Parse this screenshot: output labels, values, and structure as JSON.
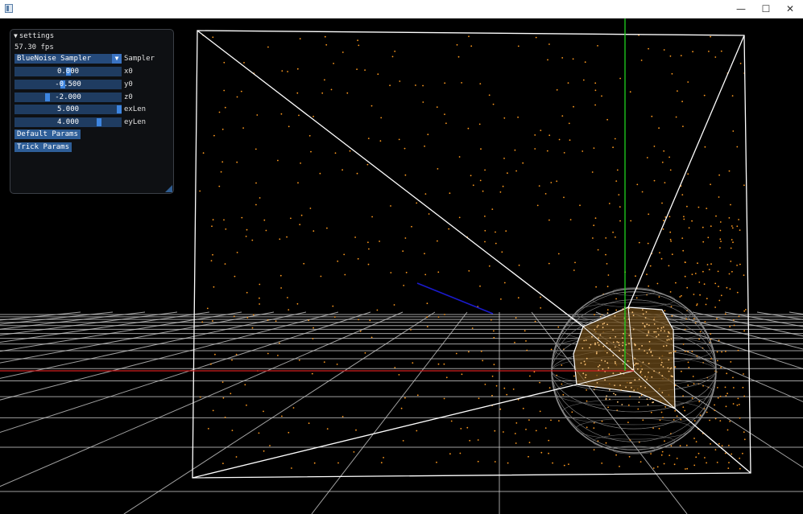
{
  "window": {
    "title": "",
    "minimize_glyph": "—",
    "maximize_glyph": "☐",
    "close_glyph": "✕"
  },
  "panel": {
    "title": "settings",
    "fps": "57.30 fps",
    "sampler": {
      "value": "BlueNoise Sampler",
      "label": "Sampler"
    },
    "params": [
      {
        "label": "x0",
        "value": "0.000",
        "fraction": 0.5
      },
      {
        "label": "y0",
        "value": "-0.500",
        "fraction": 0.45
      },
      {
        "label": "z0",
        "value": "-2.000",
        "fraction": 0.3
      },
      {
        "label": "exLen",
        "value": "5.000",
        "fraction": 1.0
      },
      {
        "label": "eyLen",
        "value": "4.000",
        "fraction": 0.8
      }
    ],
    "buttons": {
      "default": "Default Params",
      "trick": "Trick Params"
    }
  },
  "scene": {
    "colors": {
      "background": "#000000",
      "grid": "#c8c8c8",
      "frustum": "#ffffff",
      "points": "#ff9a1f",
      "axis_x": "#d42020",
      "axis_y": "#1ed21e",
      "axis_z": "#1a1acc",
      "sphere": "#8a8a8a"
    }
  }
}
